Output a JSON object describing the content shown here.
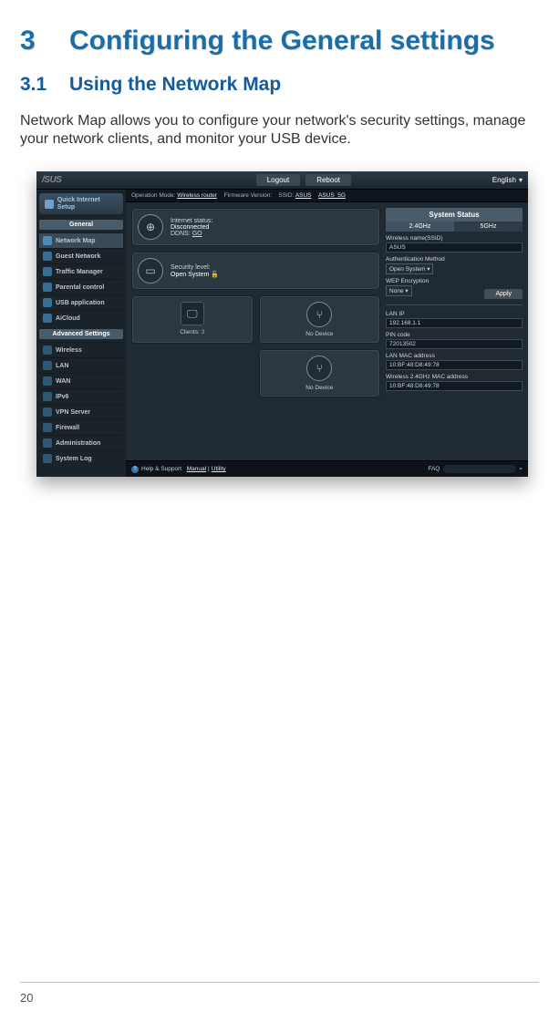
{
  "page_number": "20",
  "chapter": {
    "num": "3",
    "title": "Configuring the General settings"
  },
  "section": {
    "num": "3.1",
    "title": "Using the Network Map"
  },
  "paragraph": "Network Map allows you to configure your network's security settings, manage your network clients, and monitor your USB device.",
  "router": {
    "topbar": {
      "logout": "Logout",
      "reboot": "Reboot",
      "language": "English"
    },
    "infobar": {
      "mode_label": "Operation Mode:",
      "mode_value": "Wireless router",
      "fw_label": "Firmware Version:",
      "ssid_label": "SSID:",
      "ssid1": "ASUS",
      "ssid2": "ASUS_5G"
    },
    "sidebar": {
      "quick": "Quick Internet Setup",
      "general_header": "General",
      "general_items": [
        "Network Map",
        "Guest Network",
        "Traffic Manager",
        "Parental control",
        "USB application",
        "AiCloud"
      ],
      "advanced_header": "Advanced Settings",
      "advanced_items": [
        "Wireless",
        "LAN",
        "WAN",
        "IPv6",
        "VPN Server",
        "Firewall",
        "Administration",
        "System Log"
      ]
    },
    "main": {
      "internet_status_label": "Internet status:",
      "internet_status_value": "Disconnected",
      "ddns_label": "DDNS:",
      "ddns_value": "GO",
      "security_label": "Security level:",
      "security_value": "Open System",
      "clients_label": "Clients:",
      "clients_value": "3",
      "no_device": "No Device"
    },
    "status": {
      "title": "System Status",
      "tab1": "2.4GHz",
      "tab2": "5GHz",
      "wname_label": "Wireless name(SSID)",
      "wname_value": "ASUS",
      "auth_label": "Authentication Method",
      "auth_value": "Open System",
      "wep_label": "WEP Encryption",
      "wep_value": "None",
      "apply": "Apply",
      "lanip_label": "LAN IP",
      "lanip_value": "192.168.1.1",
      "pin_label": "PIN code",
      "pin_value": "72013502",
      "lanmac_label": "LAN MAC address",
      "lanmac_value": "10:BF:48:D8:49:78",
      "w24mac_label": "Wireless 2.4GHz MAC address",
      "w24mac_value": "10:BF:48:D8:49:78"
    },
    "footer": {
      "help_label": "Help & Support",
      "manual": "Manual",
      "sep": "|",
      "utility": "Utility",
      "faq": "FAQ"
    }
  }
}
